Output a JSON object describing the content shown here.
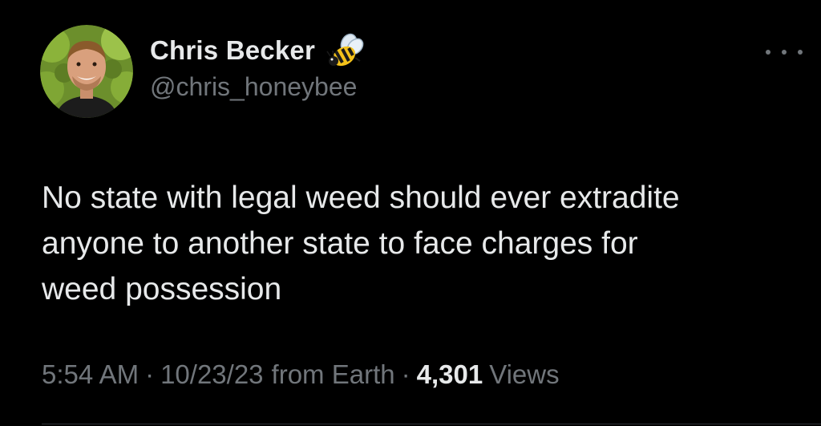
{
  "author": {
    "display_name": "Chris Becker",
    "handle": "@chris_honeybee",
    "name_emoji": "bee-icon",
    "avatar": "profile-photo"
  },
  "tweet": {
    "text": "No state with legal weed should ever extradite\nanyone to another state to face charges for\nweed possession"
  },
  "meta": {
    "time": "5:54 AM",
    "date": "10/23/23",
    "source": "from Earth",
    "separator": "·",
    "views_count": "4,301",
    "views_label": "Views"
  },
  "actions": {
    "more_icon": "more-options-icon"
  },
  "colors": {
    "background": "#000000",
    "primary_text": "#e7e9ea",
    "secondary_text": "#71767b",
    "divider": "#2f3336"
  }
}
